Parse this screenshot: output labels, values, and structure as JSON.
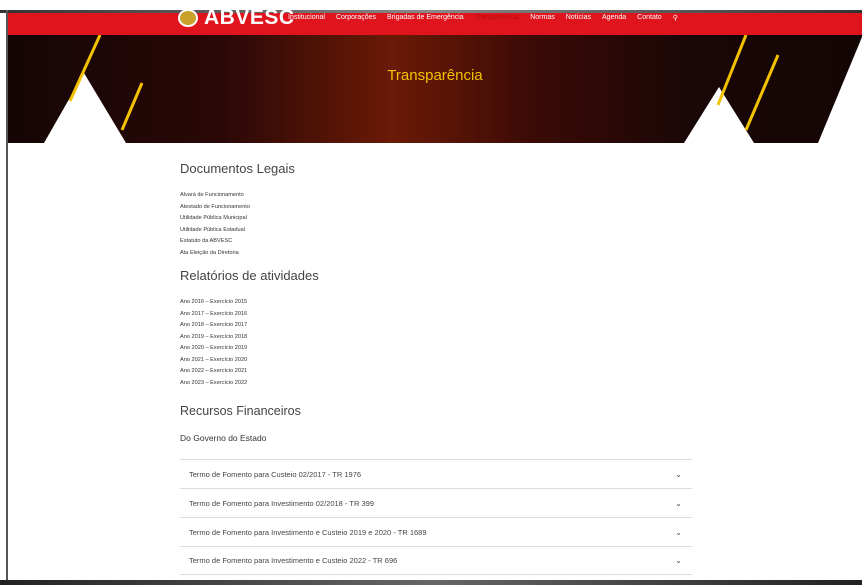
{
  "brand": {
    "name": "ABVESC"
  },
  "nav": {
    "items": [
      "Institucional",
      "Corporações",
      "Brigadas de Emergência",
      "Transparência",
      "Normas",
      "Notícias",
      "Agenda",
      "Contato"
    ],
    "search_icon": "search-icon"
  },
  "hero": {
    "title": "Transparência"
  },
  "documentos": {
    "heading": "Documentos Legais",
    "links": [
      "Alvará de Funcionamento",
      "Atestado de Funcionamento",
      "Utilidade Pública Municipal",
      "Utilidade Pública Estadual",
      "Estatuto da ABVESC",
      "Ata Eleição da Diretoria"
    ]
  },
  "relatorios": {
    "heading": "Relatórios de atividades",
    "links": [
      "Ano 2016 – Exercício 2015",
      "Ano 2017 – Exercício 2016",
      "Ano 2018 – Exercício 2017",
      "Ano 2019 – Exercício 2018",
      "Ano 2020 – Exercício 2019",
      "Ano 2021 – Exercício 2020",
      "Ano 2022 – Exercício 2021",
      "Ano 2023 – Exercício 2022"
    ]
  },
  "recursos": {
    "heading": "Recursos Financeiros",
    "subheading": "Do Governo do Estado",
    "items": [
      "Termo de Fomento para Custeio 02/2017 - TR 1976",
      "Termo de Fomento para Investimento 02/2018 - TR 399",
      "Termo de Fomento para Investimento e Custeio 2019 e 2020 - TR 1689",
      "Termo de Fomento para Investimento e Custeio 2022 - TR 696"
    ]
  },
  "colors": {
    "brand_red": "#e0141c",
    "hero_title": "#f2c200"
  }
}
